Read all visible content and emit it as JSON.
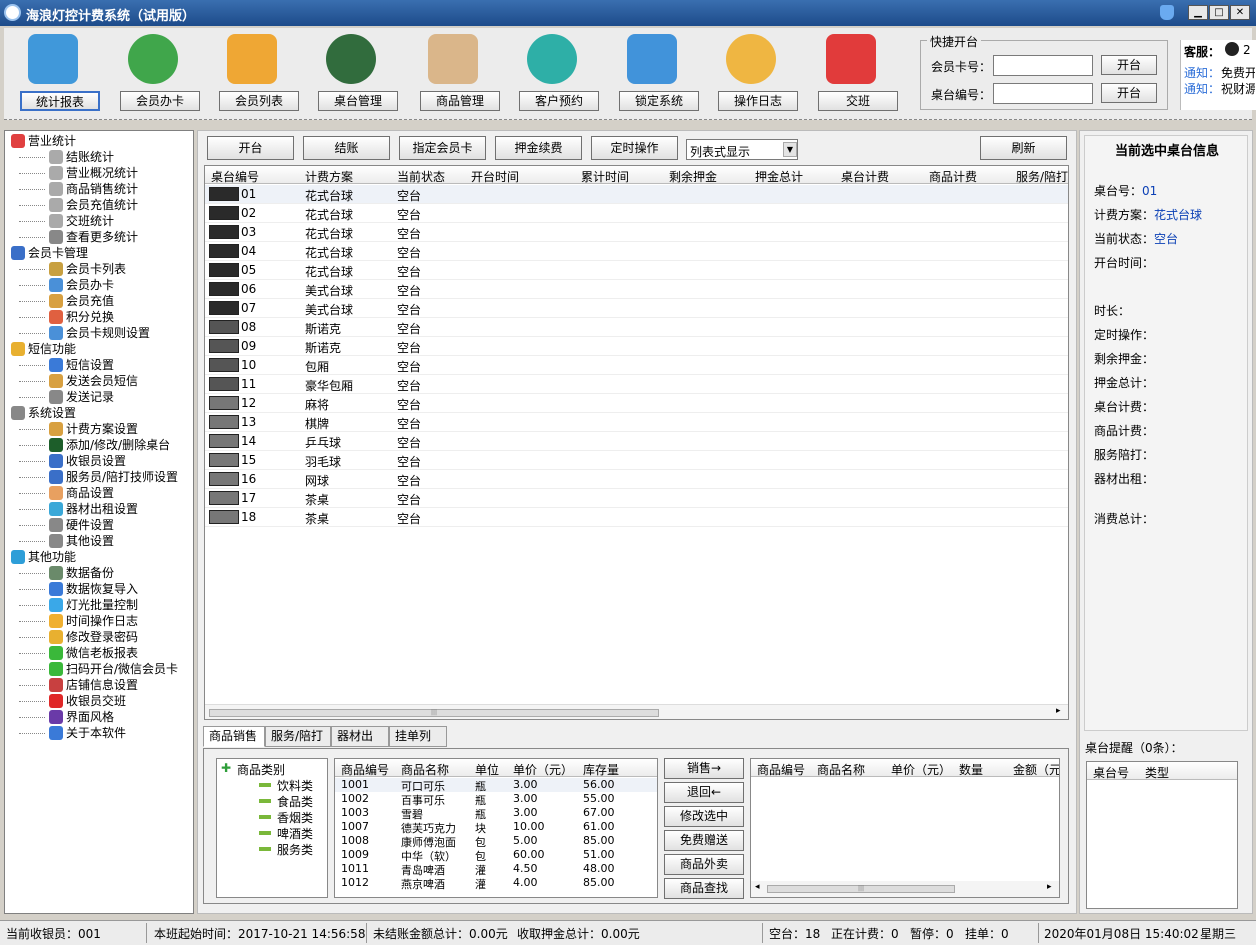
{
  "app": {
    "title": "海浪灯控计费系统（试用版）",
    "min": "▁",
    "max": "□",
    "close": "✕"
  },
  "toolbar": [
    {
      "label": "统计报表",
      "icon": "chart-icon",
      "color": "#2e8fd8"
    },
    {
      "label": "会员办卡",
      "icon": "add-user-icon",
      "color": "#2e9e3a"
    },
    {
      "label": "会员列表",
      "icon": "user-group-icon",
      "color": "#f0a020"
    },
    {
      "label": "桌台管理",
      "icon": "billiard-icon",
      "color": "#1d5e2a"
    },
    {
      "label": "商品管理",
      "icon": "tag-gear-icon",
      "color": "#d8b080"
    },
    {
      "label": "客户预约",
      "icon": "alarm-clock-icon",
      "color": "#1aa8a0"
    },
    {
      "label": "锁定系统",
      "icon": "lock-icon",
      "color": "#2f8ad8"
    },
    {
      "label": "操作日志",
      "icon": "clipboard-icon",
      "color": "#f0b030"
    },
    {
      "label": "交班",
      "icon": "spinner-icon",
      "color": "#e02828"
    }
  ],
  "quick": {
    "title": "快捷开台",
    "card_label": "会员卡号：",
    "table_label": "桌台编号：",
    "open_btn": "开台"
  },
  "service": {
    "label": "客服：",
    "prefix": "2",
    "notice1_tag": "通知：",
    "notice1": "免费开",
    "notice2_tag": "通知：",
    "notice2": "祝财源"
  },
  "tree": [
    {
      "text": "营业统计",
      "level": 0,
      "color": "#e04040"
    },
    {
      "text": "结账统计",
      "level": 1,
      "color": "#aaa"
    },
    {
      "text": "营业概况统计",
      "level": 1,
      "color": "#aaa"
    },
    {
      "text": "商品销售统计",
      "level": 1,
      "color": "#aaa"
    },
    {
      "text": "会员充值统计",
      "level": 1,
      "color": "#aaa"
    },
    {
      "text": "交班统计",
      "level": 1,
      "color": "#aaa"
    },
    {
      "text": "查看更多统计",
      "level": 1,
      "color": "#888"
    },
    {
      "text": "会员卡管理",
      "level": 0,
      "color": "#3a6fc8"
    },
    {
      "text": "会员卡列表",
      "level": 1,
      "color": "#c8a040"
    },
    {
      "text": "会员办卡",
      "level": 1,
      "color": "#4a90d8"
    },
    {
      "text": "会员充值",
      "level": 1,
      "color": "#d8a040"
    },
    {
      "text": "积分兑换",
      "level": 1,
      "color": "#e06040"
    },
    {
      "text": "会员卡规则设置",
      "level": 1,
      "color": "#4a90d8"
    },
    {
      "text": "短信功能",
      "level": 0,
      "color": "#e8b030"
    },
    {
      "text": "短信设置",
      "level": 1,
      "color": "#3a7ad8"
    },
    {
      "text": "发送会员短信",
      "level": 1,
      "color": "#d8a040"
    },
    {
      "text": "发送记录",
      "level": 1,
      "color": "#888"
    },
    {
      "text": "系统设置",
      "level": 0,
      "color": "#888"
    },
    {
      "text": "计费方案设置",
      "level": 1,
      "color": "#d8a040"
    },
    {
      "text": "添加/修改/删除桌台",
      "level": 1,
      "color": "#1d5e2a"
    },
    {
      "text": "收银员设置",
      "level": 1,
      "color": "#3a6fc8"
    },
    {
      "text": "服务员/陪打技师设置",
      "level": 1,
      "color": "#3a6fc8"
    },
    {
      "text": "商品设置",
      "level": 1,
      "color": "#e8a060"
    },
    {
      "text": "器材出租设置",
      "level": 1,
      "color": "#3aa8d8"
    },
    {
      "text": "硬件设置",
      "level": 1,
      "color": "#888"
    },
    {
      "text": "其他设置",
      "level": 1,
      "color": "#888"
    },
    {
      "text": "其他功能",
      "level": 0,
      "color": "#2e9ed8"
    },
    {
      "text": "数据备份",
      "level": 1,
      "color": "#6a8a6a"
    },
    {
      "text": "数据恢复导入",
      "level": 1,
      "color": "#3a7ad8"
    },
    {
      "text": "灯光批量控制",
      "level": 1,
      "color": "#3aa8e8"
    },
    {
      "text": "时间操作日志",
      "level": 1,
      "color": "#f0b030"
    },
    {
      "text": "修改登录密码",
      "level": 1,
      "color": "#e8b030"
    },
    {
      "text": "微信老板报表",
      "level": 1,
      "color": "#3ab83a"
    },
    {
      "text": "扫码开台/微信会员卡",
      "level": 1,
      "color": "#3ab83a"
    },
    {
      "text": "店铺信息设置",
      "level": 1,
      "color": "#c84040"
    },
    {
      "text": "收银员交班",
      "level": 1,
      "color": "#e02828"
    },
    {
      "text": "界面风格",
      "level": 1,
      "color": "#6a3aa8"
    },
    {
      "text": "关于本软件",
      "level": 1,
      "color": "#3a7ad8"
    }
  ],
  "actions": {
    "open": "开台",
    "checkout": "结账",
    "assign_card": "指定会员卡",
    "deposit": "押金续费",
    "timer": "定时操作",
    "view_mode": "列表式显示",
    "refresh": "刷新"
  },
  "table_grid": {
    "columns": [
      "桌台编号",
      "计费方案",
      "当前状态",
      "开台时间",
      "累计时间",
      "剩余押金",
      "押金总计",
      "桌台计费",
      "商品计费",
      "服务/陪打"
    ],
    "rows": [
      [
        "01",
        "花式台球",
        "空台"
      ],
      [
        "02",
        "花式台球",
        "空台"
      ],
      [
        "03",
        "花式台球",
        "空台"
      ],
      [
        "04",
        "花式台球",
        "空台"
      ],
      [
        "05",
        "花式台球",
        "空台"
      ],
      [
        "06",
        "美式台球",
        "空台"
      ],
      [
        "07",
        "美式台球",
        "空台"
      ],
      [
        "08",
        "斯诺克",
        "空台"
      ],
      [
        "09",
        "斯诺克",
        "空台"
      ],
      [
        "10",
        "包厢",
        "空台"
      ],
      [
        "11",
        "豪华包厢",
        "空台"
      ],
      [
        "12",
        "麻将",
        "空台"
      ],
      [
        "13",
        "棋牌",
        "空台"
      ],
      [
        "14",
        "乒乓球",
        "空台"
      ],
      [
        "15",
        "羽毛球",
        "空台"
      ],
      [
        "16",
        "网球",
        "空台"
      ],
      [
        "17",
        "茶桌",
        "空台"
      ],
      [
        "18",
        "茶桌",
        "空台"
      ]
    ],
    "scroll_grip": "|||"
  },
  "tabs": [
    "商品销售",
    "服务/陪打",
    "器材出租",
    "挂单列表"
  ],
  "categories": {
    "root": "商品类别",
    "items": [
      "饮料类",
      "食品类",
      "香烟类",
      "啤酒类",
      "服务类"
    ]
  },
  "products": {
    "columns": [
      "商品编号",
      "商品名称",
      "单位",
      "单价（元）",
      "库存量"
    ],
    "rows": [
      [
        "1001",
        "可口可乐",
        "瓶",
        "3.00",
        "56.00"
      ],
      [
        "1002",
        "百事可乐",
        "瓶",
        "3.00",
        "55.00"
      ],
      [
        "1003",
        "雪碧",
        "瓶",
        "3.00",
        "67.00"
      ],
      [
        "1007",
        "德芙巧克力",
        "块",
        "10.00",
        "61.00"
      ],
      [
        "1008",
        "康师傅泡面",
        "包",
        "5.00",
        "85.00"
      ],
      [
        "1009",
        "中华（软）",
        "包",
        "60.00",
        "51.00"
      ],
      [
        "1011",
        "青岛啤酒",
        "灌",
        "4.50",
        "48.00"
      ],
      [
        "1012",
        "燕京啤酒",
        "灌",
        "4.00",
        "85.00"
      ]
    ]
  },
  "sale_buttons": [
    "销售→",
    "退回←",
    "修改选中",
    "免费赠送",
    "商品外卖",
    "商品查找"
  ],
  "sold": {
    "columns": [
      "商品编号",
      "商品名称",
      "单价（元）",
      "数量",
      "金额（元"
    ],
    "scroll_left": "◂",
    "scroll_right": "▸",
    "grip": "|||"
  },
  "info": {
    "title": "当前选中桌台信息",
    "table_no_label": "桌台号：",
    "table_no": "01",
    "plan_label": "计费方案：",
    "plan": "花式台球",
    "status_label": "当前状态：",
    "status": "空台",
    "open_time_label": "开台时间：",
    "duration_label": "时长：",
    "timer_label": "定时操作：",
    "remaining_label": "剩余押金：",
    "deposit_total_label": "押金总计：",
    "table_fee_label": "桌台计费：",
    "goods_fee_label": "商品计费：",
    "service_label": "服务陪打：",
    "rental_label": "器材出租：",
    "total_label": "消费总计："
  },
  "reminder": {
    "title": "桌台提醒（0条）：",
    "columns": [
      "桌台号",
      "类型"
    ]
  },
  "statusbar": {
    "cashier": "当前收银员：001",
    "shift_start": "本班起始时间：2017-10-21 14:56:58",
    "unsettled": "未结账金额总计：0.00元",
    "deposit": "收取押金总计：0.00元",
    "idle": "空台：18",
    "billing": "正在计费：0",
    "paused": "暂停：0",
    "hold": "挂单：0",
    "datetime": "2020年01月08日 15:40:02",
    "weekday": "星期三"
  }
}
